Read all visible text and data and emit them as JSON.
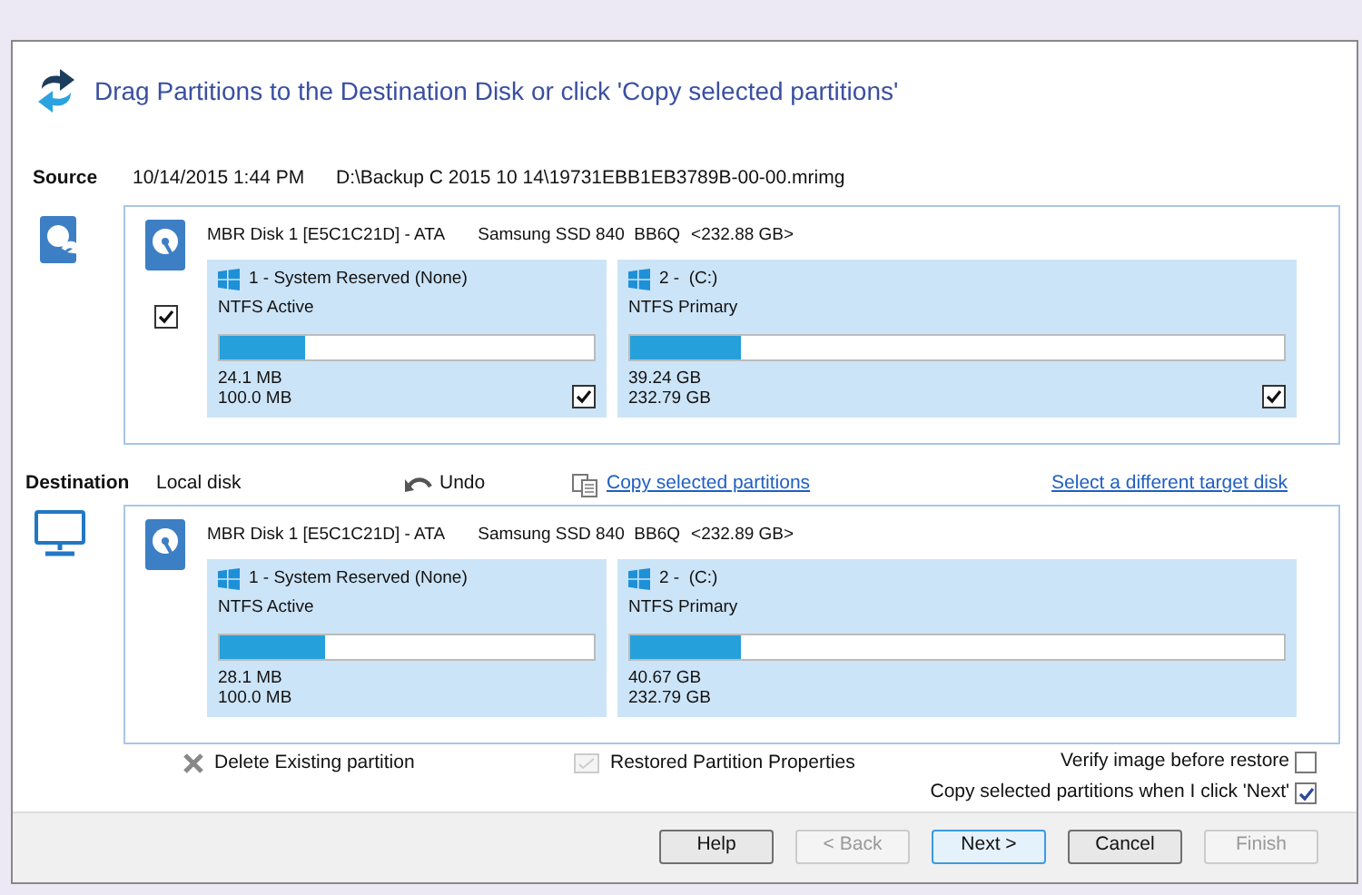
{
  "title": "Drag Partitions to the Destination Disk or click 'Copy selected partitions'",
  "source": {
    "label": "Source",
    "date": "10/14/2015 1:44 PM",
    "path": "D:\\Backup C 2015 10 14\\19731EBB1EB3789B-00-00.mrimg",
    "disk": {
      "name": "MBR Disk 1 [E5C1C21D] - ATA",
      "model": "Samsung SSD 840  BB6Q",
      "size": "<232.88 GB>",
      "checked": true,
      "partitions": [
        {
          "name": "1 - System Reserved (None)",
          "type": "NTFS Active",
          "level": 0.23,
          "used": "24.1 MB",
          "total": "100.0 MB",
          "checked": true
        },
        {
          "name": "2 -  (C:)",
          "type": "NTFS Primary",
          "level": 0.17,
          "used": "39.24 GB",
          "total": "232.79 GB",
          "checked": true
        }
      ]
    }
  },
  "destination": {
    "label": "Destination",
    "disk_type": "Local disk",
    "undo": "Undo",
    "copy_link": "Copy selected partitions",
    "select_link": "Select a different target disk",
    "disk": {
      "name": "MBR Disk 1 [E5C1C21D] - ATA",
      "model": "Samsung SSD 840  BB6Q",
      "size": "<232.89 GB>",
      "partitions": [
        {
          "name": "1 - System Reserved (None)",
          "type": "NTFS Active",
          "level": 0.28,
          "used": "28.1 MB",
          "total": "100.0 MB"
        },
        {
          "name": "2 -  (C:)",
          "type": "NTFS Primary",
          "level": 0.17,
          "used": "40.67 GB",
          "total": "232.79 GB"
        }
      ]
    }
  },
  "actions": [
    {
      "label": "Delete Existing partition",
      "kind": "delete"
    },
    {
      "label": "Restored Partition Properties",
      "kind": "properties"
    }
  ],
  "options": [
    {
      "label": "Verify image before restore",
      "checked": false
    },
    {
      "label": "Copy selected partitions when I click 'Next'",
      "checked": true
    }
  ],
  "buttons": [
    {
      "label": "Help",
      "disabled": false,
      "default": false
    },
    {
      "label": "< Back",
      "disabled": true,
      "default": false
    },
    {
      "label": "Next >",
      "disabled": false,
      "default": true
    },
    {
      "label": "Cancel",
      "disabled": false,
      "default": false
    },
    {
      "label": "Finish",
      "disabled": true,
      "default": false
    }
  ]
}
